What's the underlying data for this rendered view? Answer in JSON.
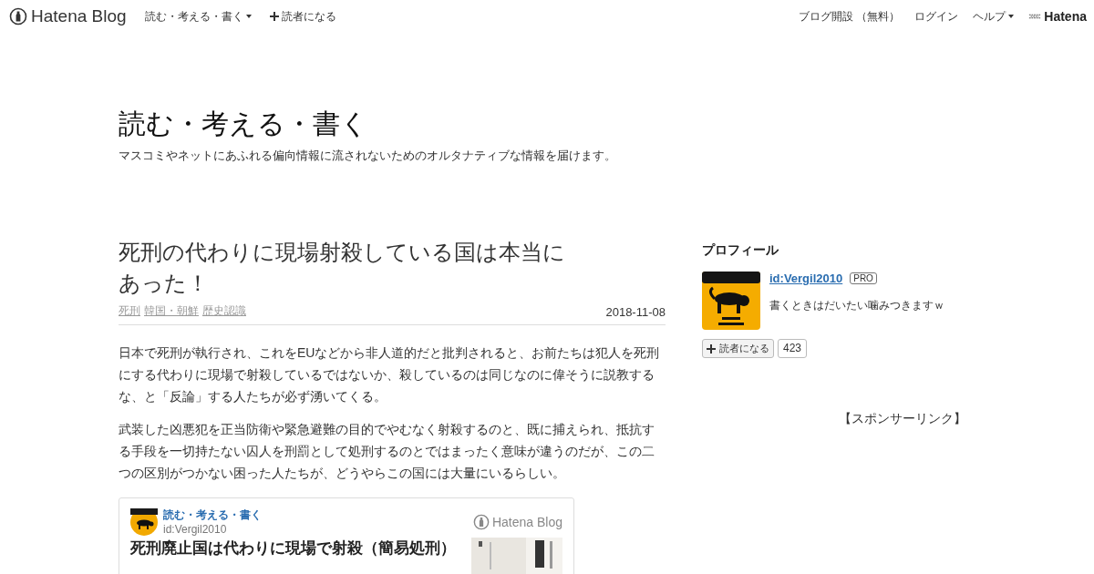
{
  "header": {
    "logo": "Hatena Blog",
    "blog_menu": "読む・考える・書く",
    "subscribe": "読者になる",
    "open_blog": "ブログ開設 （無料）",
    "login": "ログイン",
    "help": "ヘルプ",
    "hatena": "Hatena"
  },
  "blog": {
    "title": "読む・考える・書く",
    "description": "マスコミやネットにあふれる偏向情報に流されないためのオルタナティブな情報を届けます。"
  },
  "article": {
    "title": "死刑の代わりに現場射殺している国は本当にあった！",
    "categories": [
      "死刑",
      "韓国・朝鮮",
      "歴史認識"
    ],
    "date": "2018-11-08",
    "paragraphs": [
      "日本で死刑が執行され、これをEUなどから非人道的だと批判されると、お前たちは犯人を死刑にする代わりに現場で射殺しているではないか、殺しているのは同じなのに偉そうに説教するな、と「反論」する人たちが必ず湧いてくる。",
      "武装した凶悪犯を正当防衛や緊急避難の目的でやむなく射殺するのと、既に捕えられ、抵抗する手段を一切持たない囚人を刑罰として処刑するのとではまったく意味が違うのだが、この二つの区別がつかない困った人たちが、どうやらこの国には大量にいるらしい。"
    ],
    "embed": {
      "blog_name": "読む・考える・書く",
      "user": "id:Vergil2010",
      "logo": "Hatena Blog",
      "title": "死刑廃止国は代わりに現場で射殺（簡易処刑）"
    }
  },
  "sidebar": {
    "profile_heading": "プロフィール",
    "user": "id:Vergil2010",
    "badge": "PRO",
    "bio": "書くときはだいたい噛みつきますｗ",
    "subscribe": "読者になる",
    "subscribers": "423",
    "sponsor": "【スポンサーリンク】"
  }
}
